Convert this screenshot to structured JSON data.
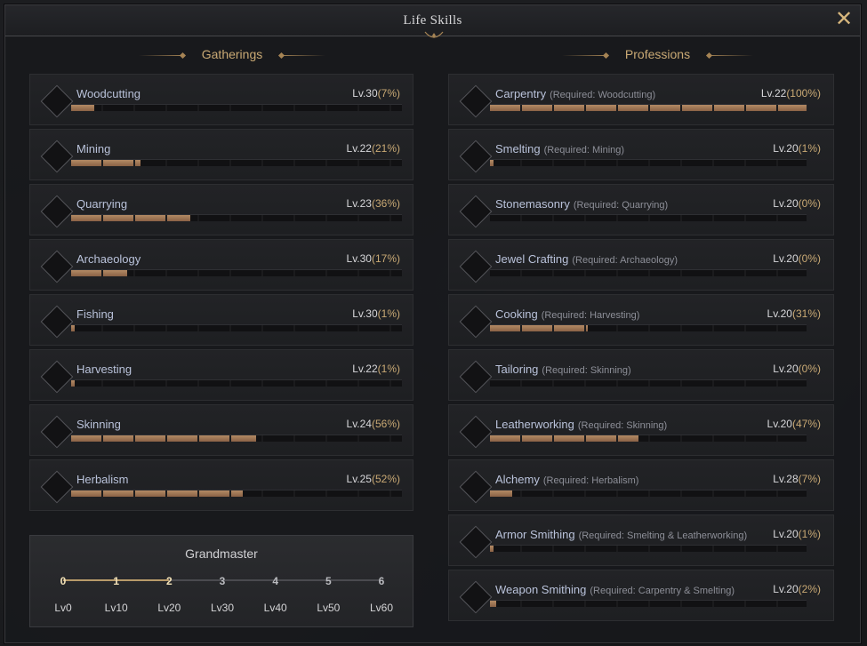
{
  "window": {
    "title": "Life Skills",
    "close_icon": "close-x-icon"
  },
  "gatherings": {
    "header": "Gatherings",
    "items": [
      {
        "name": "Woodcutting",
        "icon": "woodcutting-icon",
        "level": "Lv.30",
        "percent": "(7%)",
        "progress": 0.07
      },
      {
        "name": "Mining",
        "icon": "mining-icon",
        "level": "Lv.22",
        "percent": "(21%)",
        "progress": 0.21
      },
      {
        "name": "Quarrying",
        "icon": "quarrying-icon",
        "level": "Lv.23",
        "percent": "(36%)",
        "progress": 0.36
      },
      {
        "name": "Archaeology",
        "icon": "archaeology-icon",
        "level": "Lv.30",
        "percent": "(17%)",
        "progress": 0.17
      },
      {
        "name": "Fishing",
        "icon": "fishing-icon",
        "level": "Lv.30",
        "percent": "(1%)",
        "progress": 0.01
      },
      {
        "name": "Harvesting",
        "icon": "harvesting-icon",
        "level": "Lv.22",
        "percent": "(1%)",
        "progress": 0.01
      },
      {
        "name": "Skinning",
        "icon": "skinning-icon",
        "level": "Lv.24",
        "percent": "(56%)",
        "progress": 0.56
      },
      {
        "name": "Herbalism",
        "icon": "herbalism-icon",
        "level": "Lv.25",
        "percent": "(52%)",
        "progress": 0.52
      }
    ]
  },
  "professions": {
    "header": "Professions",
    "items": [
      {
        "name": "Carpentry",
        "req": "(Required: Woodcutting)",
        "icon": "carpentry-icon",
        "level": "Lv.22",
        "percent": "(100%)",
        "progress": 1.0
      },
      {
        "name": "Smelting",
        "req": "(Required: Mining)",
        "icon": "smelting-icon",
        "level": "Lv.20",
        "percent": "(1%)",
        "progress": 0.01
      },
      {
        "name": "Stonemasonry",
        "req": "(Required: Quarrying)",
        "icon": "stonemasonry-icon",
        "level": "Lv.20",
        "percent": "(0%)",
        "progress": 0.0
      },
      {
        "name": "Jewel Crafting",
        "req": "(Required: Archaeology)",
        "icon": "jewel-crafting-icon",
        "level": "Lv.20",
        "percent": "(0%)",
        "progress": 0.0
      },
      {
        "name": "Cooking",
        "req": "(Required: Harvesting)",
        "icon": "cooking-icon",
        "level": "Lv.20",
        "percent": "(31%)",
        "progress": 0.31
      },
      {
        "name": "Tailoring",
        "req": "(Required: Skinning)",
        "icon": "tailoring-icon",
        "level": "Lv.20",
        "percent": "(0%)",
        "progress": 0.0
      },
      {
        "name": "Leatherworking",
        "req": "(Required: Skinning)",
        "icon": "leatherworking-icon",
        "level": "Lv.20",
        "percent": "(47%)",
        "progress": 0.47
      },
      {
        "name": "Alchemy",
        "req": "(Required: Herbalism)",
        "icon": "alchemy-icon",
        "level": "Lv.28",
        "percent": "(7%)",
        "progress": 0.07
      },
      {
        "name": "Armor Smithing",
        "req": "(Required: Smelting & Leatherworking)",
        "icon": "armor-smithing-icon",
        "level": "Lv.20",
        "percent": "(1%)",
        "progress": 0.01
      },
      {
        "name": "Weapon Smithing",
        "req": "(Required: Carpentry & Smelting)",
        "icon": "weapon-smithing-icon",
        "level": "Lv.20",
        "percent": "(2%)",
        "progress": 0.02
      }
    ]
  },
  "grandmaster": {
    "title": "Grandmaster",
    "reached_stage": 2,
    "stages": [
      {
        "num": "0",
        "label": "Lv0",
        "achieved": true
      },
      {
        "num": "1",
        "label": "Lv10",
        "achieved": true
      },
      {
        "num": "2",
        "label": "Lv20",
        "achieved": true
      },
      {
        "num": "3",
        "label": "Lv30",
        "achieved": false
      },
      {
        "num": "4",
        "label": "Lv40",
        "achieved": false
      },
      {
        "num": "5",
        "label": "Lv50",
        "achieved": false
      },
      {
        "num": "6",
        "label": "Lv60",
        "achieved": false
      }
    ]
  },
  "colors": {
    "accent_gold": "#c9a974",
    "bar_fill": "#b38a64",
    "name_blue": "#b9c2da"
  }
}
